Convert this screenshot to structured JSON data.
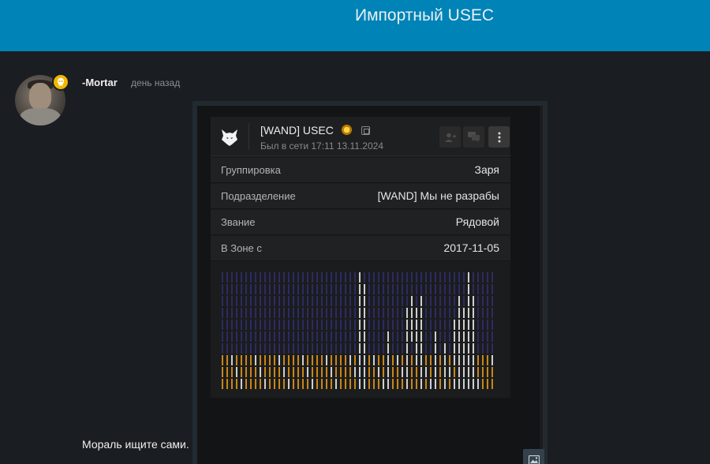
{
  "header": {
    "title": "Импортный USEC"
  },
  "post": {
    "author": "-Mortar",
    "time": "день назад",
    "text": "Мораль ищите сами."
  },
  "profile_card": {
    "name": "[WAND] USEC",
    "status": "Был в сети 17:11 13.11.2024",
    "rows": [
      {
        "key": "Группировка",
        "value": "Заря"
      },
      {
        "key": "Подразделение",
        "value": "[WAND] Мы не разрабы"
      },
      {
        "key": "Звание",
        "value": "Рядовой"
      },
      {
        "key": "В Зоне с",
        "value": "2017-11-05"
      }
    ]
  },
  "colors": {
    "header_bg": "#0083b6",
    "page_bg": "#1a1d21",
    "badge": "#f2b700",
    "grid_navy": "#2b2c62",
    "grid_white": "#cfcfcf",
    "grid_gold": "#c88618"
  },
  "icons": [
    "skull-badge-icon",
    "wolf-logo-icon",
    "rank-medal-icon",
    "copy-icon",
    "add-friend-icon",
    "message-icon",
    "more-vertical-icon",
    "image-icon"
  ]
}
